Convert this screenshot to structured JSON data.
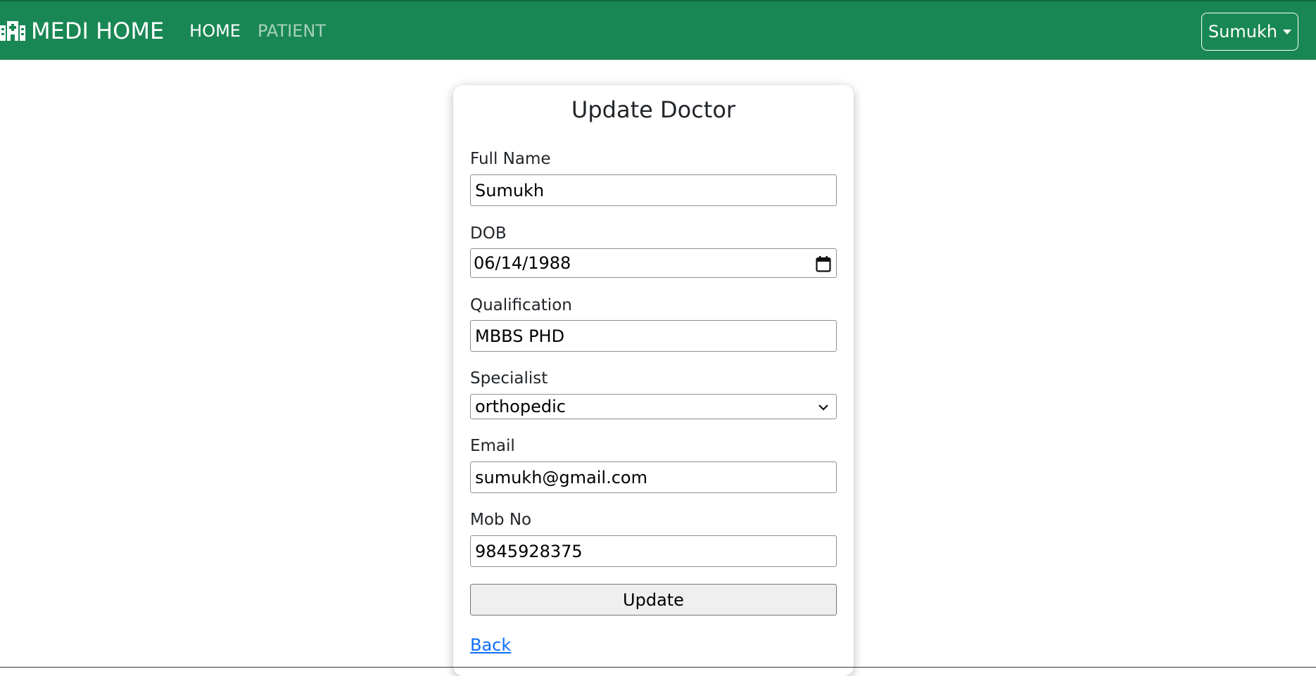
{
  "navbar": {
    "brand": "MEDI HOME",
    "links": [
      {
        "label": "HOME",
        "active": true
      },
      {
        "label": "PATIENT",
        "active": false
      }
    ],
    "user_menu": "Sumukh",
    "color": "#198754"
  },
  "form": {
    "title": "Update Doctor",
    "fields": {
      "full_name": {
        "label": "Full Name",
        "value": "Sumukh"
      },
      "dob": {
        "label": "DOB",
        "value": "06/14/1988"
      },
      "qualification": {
        "label": "Qualification",
        "value": "MBBS PHD"
      },
      "specialist": {
        "label": "Specialist",
        "value": "orthopedic"
      },
      "email": {
        "label": "Email",
        "value": "sumukh@gmail.com"
      },
      "mob_no": {
        "label": "Mob No",
        "value": "9845928375"
      }
    },
    "submit_label": "Update",
    "back_label": "Back"
  },
  "icons": {
    "brand": "hospital-icon",
    "calendar": "calendar-icon",
    "select": "chevron-down-icon",
    "dropdown": "caret-down-icon"
  }
}
